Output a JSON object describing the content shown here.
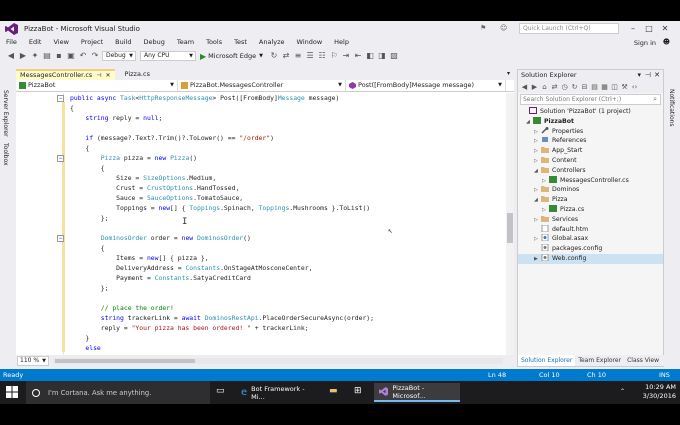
{
  "window": {
    "title": "PizzaBot - Microsoft Visual Studio"
  },
  "quick_launch": {
    "placeholder": "Quick Launch (Ctrl+Q)"
  },
  "menu": [
    "File",
    "Edit",
    "View",
    "Project",
    "Build",
    "Debug",
    "Team",
    "Tools",
    "Test",
    "Analyze",
    "Window",
    "Help"
  ],
  "signin": "Sign in",
  "toolbar": {
    "config": "Debug",
    "platform": "Any CPU",
    "run_target": "Microsoft Edge"
  },
  "left_strip": {
    "tab1": "Server Explorer",
    "tab2": "Toolbox"
  },
  "right_strip": {
    "tab1": "Notifications"
  },
  "doc_tabs": [
    {
      "label": "MessagesController.cs"
    },
    {
      "label": "Pizza.cs"
    }
  ],
  "nav": {
    "project": "PizzaBot",
    "class": "PizzaBot.MessagesController",
    "member": "Post([FromBody]Message message)"
  },
  "code": [
    [
      [
        "kw",
        "public async "
      ],
      [
        "ty",
        "Task"
      ],
      [
        "",
        "<"
      ],
      [
        "ty",
        "HttpResponseMessage"
      ],
      [
        "",
        "> Post([FromBody]"
      ],
      [
        "ty",
        "Message"
      ],
      [
        "",
        " message)"
      ]
    ],
    [
      [
        "",
        "{"
      ]
    ],
    [
      [
        "",
        "    "
      ],
      [
        "kw",
        "string"
      ],
      [
        "",
        " reply = "
      ],
      [
        "kw",
        "null"
      ],
      [
        "",
        ";"
      ]
    ],
    [
      [
        "",
        ""
      ]
    ],
    [
      [
        "",
        "    "
      ],
      [
        "kw",
        "if"
      ],
      [
        "",
        " (message?.Text?.Trim()?.ToLower() == "
      ],
      [
        "str",
        "\"/order\""
      ],
      [
        "",
        ")"
      ]
    ],
    [
      [
        "",
        "    {"
      ]
    ],
    [
      [
        "",
        "        "
      ],
      [
        "ty",
        "Pizza"
      ],
      [
        "",
        " pizza = "
      ],
      [
        "kw",
        "new "
      ],
      [
        "ty",
        "Pizza"
      ],
      [
        "",
        "()"
      ]
    ],
    [
      [
        "",
        "        {"
      ]
    ],
    [
      [
        "",
        "            Size = "
      ],
      [
        "ty",
        "SizeOptions"
      ],
      [
        "",
        ".Medium,"
      ]
    ],
    [
      [
        "",
        "            Crust = "
      ],
      [
        "ty",
        "CrustOptions"
      ],
      [
        "",
        ".HandTossed,"
      ]
    ],
    [
      [
        "",
        "            Sauce = "
      ],
      [
        "ty",
        "SauceOptions"
      ],
      [
        "",
        ".TomatoSauce,"
      ]
    ],
    [
      [
        "",
        "            Toppings = "
      ],
      [
        "kw",
        "new"
      ],
      [
        "",
        "[] { "
      ],
      [
        "ty",
        "Toppings"
      ],
      [
        "",
        ".Spinach, "
      ],
      [
        "ty",
        "Toppings"
      ],
      [
        "",
        ".Mushrooms }.ToList()"
      ]
    ],
    [
      [
        "",
        "        };"
      ]
    ],
    [
      [
        "",
        ""
      ]
    ],
    [
      [
        "",
        "        "
      ],
      [
        "ty",
        "DominosOrder"
      ],
      [
        "",
        " order = "
      ],
      [
        "kw",
        "new "
      ],
      [
        "ty",
        "DominosOrder"
      ],
      [
        "",
        "()"
      ]
    ],
    [
      [
        "",
        "        {"
      ]
    ],
    [
      [
        "",
        "            Items = "
      ],
      [
        "kw",
        "new"
      ],
      [
        "",
        "[] { pizza },"
      ]
    ],
    [
      [
        "",
        "            DeliveryAddress = "
      ],
      [
        "ty",
        "Constants"
      ],
      [
        "",
        ".OnStageAtMosconeCenter,"
      ]
    ],
    [
      [
        "",
        "            Payment = "
      ],
      [
        "ty",
        "Constants"
      ],
      [
        "",
        ".SatyaCreditCard"
      ]
    ],
    [
      [
        "",
        "        };"
      ]
    ],
    [
      [
        "",
        ""
      ]
    ],
    [
      [
        "",
        "        "
      ],
      [
        "cm",
        "// place the order!"
      ]
    ],
    [
      [
        "",
        "        "
      ],
      [
        "kw",
        "string"
      ],
      [
        "",
        " trackerLink = "
      ],
      [
        "kw",
        "await "
      ],
      [
        "ty",
        "DominosRestApi"
      ],
      [
        "",
        ".PlaceOrderSecureAsync(order);"
      ]
    ],
    [
      [
        "",
        "        reply = "
      ],
      [
        "str",
        "\"Your pizza has been ordered! \""
      ],
      [
        "",
        " + trackerLink;"
      ]
    ],
    [
      [
        "",
        "    }"
      ]
    ],
    [
      [
        "",
        "    "
      ],
      [
        "kw",
        "else"
      ]
    ]
  ],
  "zoom": "110 %",
  "solution_explorer": {
    "title": "Solution Explorer",
    "search_placeholder": "Search Solution Explorer (Ctrl+;)",
    "tree": [
      {
        "label": "Solution 'PizzaBot' (1 project)",
        "icon": "solution-icon"
      },
      {
        "label": "PizzaBot",
        "icon": "csharp-project-icon"
      },
      {
        "label": "Properties",
        "icon": "wrench-icon"
      },
      {
        "label": "References",
        "icon": "references-icon"
      },
      {
        "label": "App_Start",
        "icon": "folder-icon"
      },
      {
        "label": "Content",
        "icon": "folder-icon"
      },
      {
        "label": "Controllers",
        "icon": "folder-icon"
      },
      {
        "label": "MessagesController.cs",
        "icon": "csharp-file-icon"
      },
      {
        "label": "Dominos",
        "icon": "folder-icon"
      },
      {
        "label": "Pizza",
        "icon": "folder-icon"
      },
      {
        "label": "Pizza.cs",
        "icon": "csharp-file-icon"
      },
      {
        "label": "Services",
        "icon": "folder-icon"
      },
      {
        "label": "default.htm",
        "icon": "html-file-icon"
      },
      {
        "label": "Global.asax",
        "icon": "asax-file-icon"
      },
      {
        "label": "packages.config",
        "icon": "config-file-icon"
      },
      {
        "label": "Web.config",
        "icon": "config-file-icon"
      }
    ],
    "tabs": [
      "Solution Explorer",
      "Team Explorer",
      "Class View"
    ]
  },
  "status": {
    "state": "Ready",
    "ln": "Ln 48",
    "col": "Col 10",
    "ch": "Ch 10",
    "mode": "INS"
  },
  "taskbar": {
    "cortana": "I'm Cortana. Ask me anything.",
    "tasks": [
      "Bot Framework - Mi...",
      "PizzaBot - Microsof..."
    ],
    "time": "10:29 AM",
    "date": "3/30/2016"
  },
  "colors": {
    "status_blue": "#007acc",
    "keyword": "#0000ff",
    "type": "#2b91af",
    "string": "#a31515",
    "comment": "#008000",
    "vs_purple": "#68217a"
  }
}
